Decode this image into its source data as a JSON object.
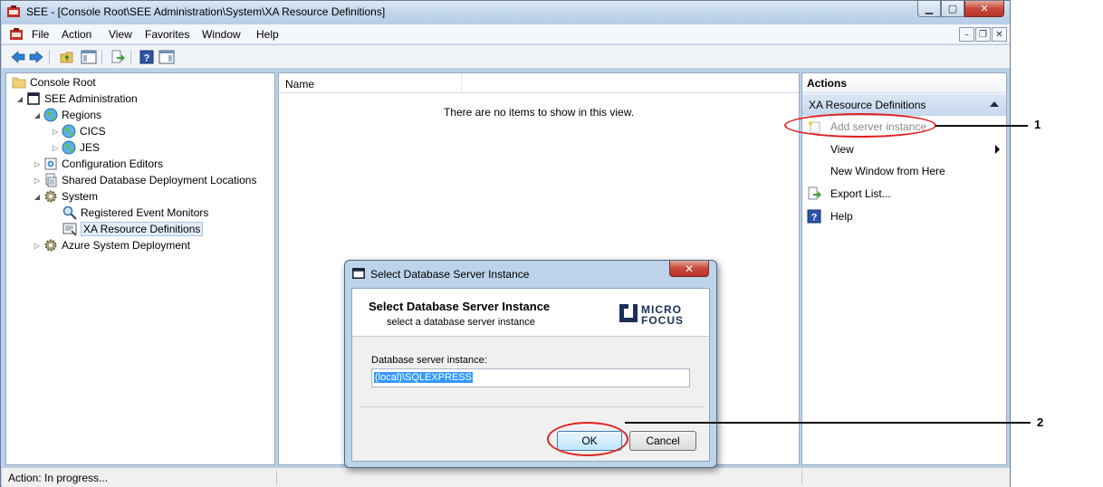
{
  "window": {
    "title": "SEE - [Console Root\\SEE Administration\\System\\XA Resource Definitions]",
    "controls": {
      "minimize": "▁",
      "maximize": "▢",
      "close": "✕"
    }
  },
  "menubar": {
    "items": [
      "File",
      "Action",
      "View",
      "Favorites",
      "Window",
      "Help"
    ],
    "mdi_controls": {
      "minimize": "–",
      "restore": "❐",
      "close": "✕"
    }
  },
  "toolbar": {
    "buttons": [
      "back-icon",
      "forward-icon",
      "up-folder-icon",
      "show-hide-tree-icon",
      "export-list-icon",
      "help-icon",
      "show-hide-action-pane-icon"
    ]
  },
  "tree": {
    "items": [
      {
        "label": "Console Root",
        "icon": "folder-icon"
      },
      {
        "label": "SEE Administration",
        "icon": "console-icon"
      },
      {
        "label": "Regions",
        "icon": "globe-icon"
      },
      {
        "label": "CICS",
        "icon": "globe-icon"
      },
      {
        "label": "JES",
        "icon": "globe-icon"
      },
      {
        "label": "Configuration Editors",
        "icon": "config-editor-icon"
      },
      {
        "label": "Shared Database Deployment Locations",
        "icon": "database-icon"
      },
      {
        "label": "System",
        "icon": "gear-icon"
      },
      {
        "label": "Registered Event Monitors",
        "icon": "magnifier-icon"
      },
      {
        "label": "XA Resource Definitions",
        "icon": "xa-resource-icon"
      },
      {
        "label": "Azure System Deployment",
        "icon": "gear-icon"
      }
    ]
  },
  "list": {
    "columns": [
      "Name"
    ],
    "empty_message": "There are no items to show in this view."
  },
  "actions": {
    "title": "Actions",
    "section": "XA Resource Definitions",
    "items": [
      {
        "label": "Add server instance",
        "enabled": false
      },
      {
        "label": "View",
        "has_submenu": true
      },
      {
        "label": "New Window from Here"
      },
      {
        "label": "Export List..."
      },
      {
        "label": "Help"
      }
    ]
  },
  "status": {
    "text": "Action:  In progress..."
  },
  "annotations": {
    "callout1": "1",
    "callout2": "2",
    "color": "#e21f1f"
  },
  "dialog": {
    "title": "Select Database Server Instance",
    "close": "✕",
    "heading": "Select Database Server Instance",
    "subheading": "select a database server instance",
    "logo_text": [
      "MICRO",
      "FOCUS"
    ],
    "field_label": "Database server instance:",
    "field_value": "(local)\\SQLEXPRESS",
    "ok_label": "OK",
    "cancel_label": "Cancel"
  }
}
